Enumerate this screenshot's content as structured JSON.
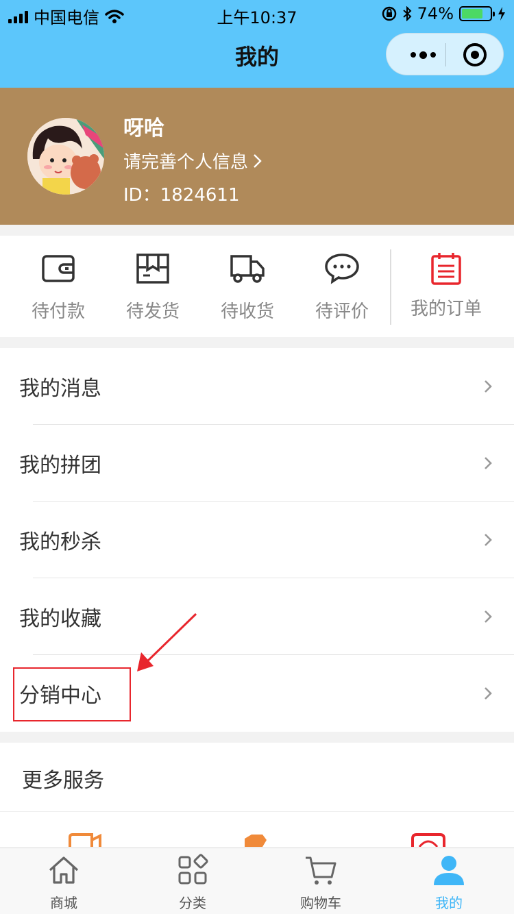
{
  "status": {
    "carrier": "中国电信",
    "time": "上午10:37",
    "battery": "74%",
    "battery_level": 0.74
  },
  "nav": {
    "title": "我的"
  },
  "profile": {
    "name": "呀哈",
    "complete_info": "请完善个人信息",
    "id_label": "ID：",
    "id_value": "1824611"
  },
  "orders": {
    "items": [
      {
        "label": "待付款",
        "icon": "wallet-icon"
      },
      {
        "label": "待发货",
        "icon": "package-icon"
      },
      {
        "label": "待收货",
        "icon": "truck-icon"
      },
      {
        "label": "待评价",
        "icon": "comment-icon"
      }
    ],
    "my_orders": {
      "label": "我的订单",
      "icon": "clipboard-icon"
    }
  },
  "menu": {
    "items": [
      {
        "label": "我的消息"
      },
      {
        "label": "我的拼团"
      },
      {
        "label": "我的秒杀"
      },
      {
        "label": "我的收藏"
      },
      {
        "label": "分销中心"
      }
    ]
  },
  "services": {
    "title": "更多服务"
  },
  "tabbar": {
    "items": [
      {
        "label": "商城",
        "icon": "home-icon"
      },
      {
        "label": "分类",
        "icon": "category-icon"
      },
      {
        "label": "购物车",
        "icon": "cart-icon"
      },
      {
        "label": "我的",
        "icon": "user-icon"
      }
    ]
  },
  "colors": {
    "nav_bg": "#5cc6fb",
    "profile_bg": "#b08a5a",
    "accent_red": "#e8262d",
    "tab_active": "#3fb6f7"
  }
}
